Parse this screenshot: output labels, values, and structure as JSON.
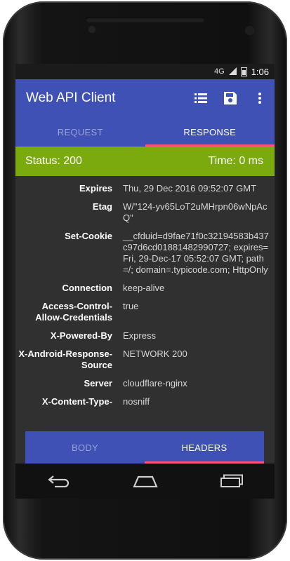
{
  "status_bar": {
    "network": "4G",
    "time": "1:06"
  },
  "app": {
    "title": "Web API Client"
  },
  "top_tabs": [
    {
      "label": "REQUEST",
      "active": false
    },
    {
      "label": "RESPONSE",
      "active": true
    }
  ],
  "response": {
    "status": "Status: 200",
    "time": "Time: 0 ms",
    "status_color": "#7aaa0e"
  },
  "headers": [
    {
      "key": "Expires",
      "value": "Thu, 29 Dec 2016 09:52:07 GMT"
    },
    {
      "key": "Etag",
      "value": "W/\"124-yv65LoT2uMHrpn06wNpAcQ\""
    },
    {
      "key": "Set-Cookie",
      "value": "__cfduid=d9fae71f0c32194583b437c97d6cd01881482990727; expires=Fri, 29-Dec-17 05:52:07 GMT; path=/; domain=.typicode.com; HttpOnly"
    },
    {
      "key": "Connection",
      "value": "keep-alive"
    },
    {
      "key": "Access-Control-Allow-Credentials",
      "value": "true"
    },
    {
      "key": "X-Powered-By",
      "value": "Express"
    },
    {
      "key": "X-Android-Response-Source",
      "value": "NETWORK 200"
    },
    {
      "key": "Server",
      "value": "cloudflare-nginx"
    },
    {
      "key": "X-Content-Type-",
      "value": "nosniff"
    }
  ],
  "bottom_tabs": [
    {
      "label": "BODY",
      "active": false
    },
    {
      "label": "HEADERS",
      "active": true
    }
  ],
  "colors": {
    "primary": "#3f51b5",
    "accent": "#ff4f7b"
  }
}
